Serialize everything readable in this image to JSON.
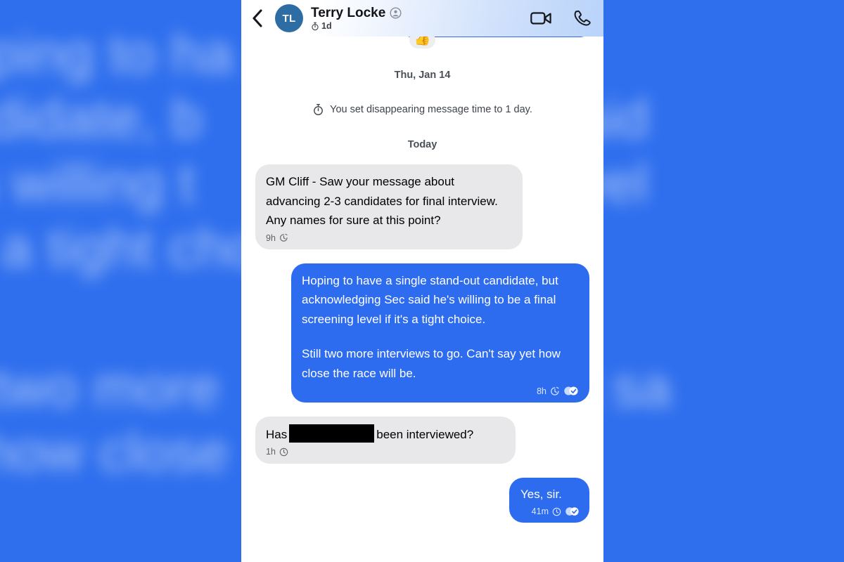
{
  "background": {
    "blur_text_line_1": "oping to ha            d-out",
    "blur_text_line_2": "ndidate, b            g Sec said",
    "blur_text_line_3": "'s willing t            ening level",
    "blur_text_line_4": "s a tight cho",
    "blur_text_line_5": "ll two more            o. Can't sa",
    "blur_text_line_6": "t how close"
  },
  "header": {
    "back_label": "Back",
    "avatar_initials": "TL",
    "contact_name": "Terry Locke",
    "verified_icon": "profile-badge-icon",
    "disappearing_timer": "1d",
    "timer_icon": "stopwatch-icon",
    "video_call_label": "Video call",
    "voice_call_label": "Voice call"
  },
  "conversation": {
    "reaction": {
      "emoji": "👍"
    },
    "date_separator_1": "Thu, Jan 14",
    "system_message": "You set disappearing message time to 1 day.",
    "system_icon": "stopwatch-icon",
    "date_separator_2": "Today",
    "messages": [
      {
        "id": "msg-1",
        "direction": "in",
        "text": "GM Cliff - Saw your message about advancing 2-3 candidates for final interview. Any names for sure at this point?",
        "time": "9h",
        "timer_icon": "disappearing-timer-icon",
        "receipt": null
      },
      {
        "id": "msg-2",
        "direction": "out",
        "paragraph_1": "Hoping to have a single stand-out candidate, but acknowledging Sec said he's willing to be a final screening level if it's a tight choice.",
        "paragraph_2": "Still two more interviews to go. Can't say yet how close the race will be.",
        "time": "8h",
        "timer_icon": "disappearing-timer-icon",
        "receipt": "read-receipt-double-check-icon"
      },
      {
        "id": "msg-3",
        "direction": "in",
        "text_before": "Has",
        "redacted": true,
        "text_after": "been interviewed?",
        "time": "1h",
        "timer_icon": "clock-icon",
        "receipt": null
      },
      {
        "id": "msg-4",
        "direction": "out",
        "text": "Yes, sir.",
        "time": "41m",
        "timer_icon": "clock-icon",
        "receipt": "read-receipt-double-check-icon"
      }
    ]
  },
  "colors": {
    "outgoing_bubble": "#2d6bef",
    "incoming_bubble": "#e8e8ea",
    "avatar": "#2e6da4",
    "background": "#2f6fee",
    "redaction": "#000000"
  }
}
